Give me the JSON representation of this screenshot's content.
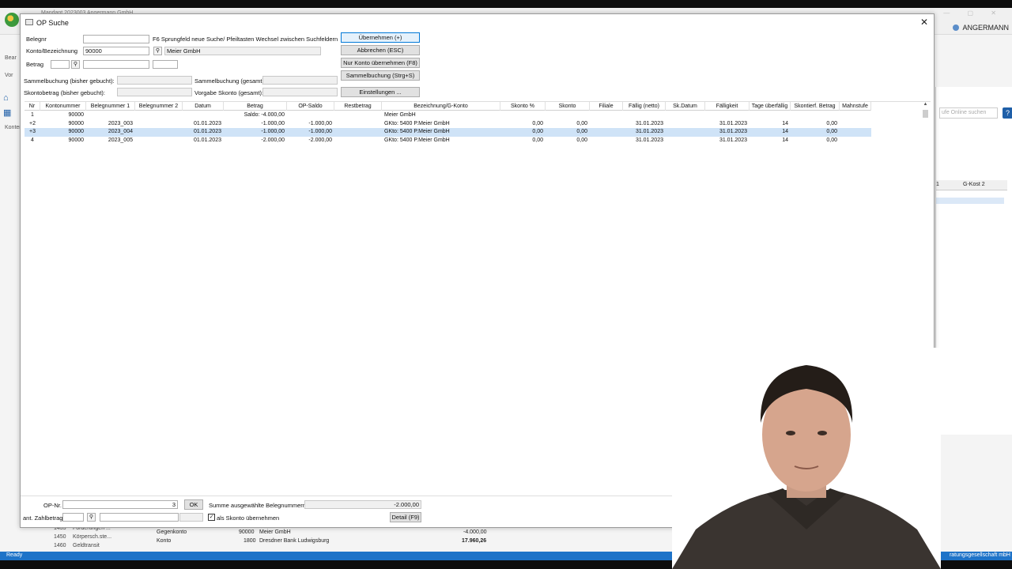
{
  "background_app": {
    "doc_title": "Mandant 2023003 Angermann GmbH",
    "user_name": "ANGERMANN",
    "left_labels": [
      "Bear",
      "Vor",
      "Konten"
    ],
    "search_placeholder": "ufe Online suchen",
    "gkost_col_prefix": "1",
    "gkost_col": "G-Kost 2",
    "bottom_rows": [
      {
        "label": "Gegenkonto",
        "konto": "90000",
        "name": "Meier GmbH",
        "amount": "-4.000,00"
      },
      {
        "label": "Konto",
        "konto": "1800",
        "name": "Dresdner Bank Ludwigsburg",
        "amount": "17.960,26"
      }
    ],
    "tree_rows": [
      {
        "num": "1435",
        "name": "Forderungen ..."
      },
      {
        "num": "1450",
        "name": "Körpersch.ste..."
      },
      {
        "num": "1460",
        "name": "Geldtransit"
      }
    ],
    "status_left": "Ready",
    "status_right": "ratungsgesellschaft mbH"
  },
  "dialog": {
    "title": "OP Suche",
    "close_symbol": "✕",
    "belegnr_label": "Belegnr",
    "belegnr_value": "",
    "hint_text": "F6 Sprungfeld neue Suche/ Pfeiltasten Wechsel zwischen Suchfeldern",
    "konto_label": "Konto/Bezeichnung",
    "konto_value": "90000",
    "konto_name": "Meier GmbH",
    "betrag_label": "Betrag",
    "sammel_bisher_label": "Sammelbuchung (bisher gebucht):",
    "sammel_gesamt_label": "Sammelbuchung (gesamt):",
    "skonto_bisher_label": "Skontobetrag (bisher gebucht):",
    "vorgabe_skonto_label": "Vorgabe Skonto (gesamt):",
    "buttons": {
      "uebernehmen": "Übernehmen (+)",
      "abbrechen": "Abbrechen (ESC)",
      "nur_konto": "Nur Konto übernehmen (F8)",
      "sammelbuchung": "Sammelbuchung (Strg+S)",
      "einstellungen": "Einstellungen ..."
    }
  },
  "table": {
    "headers": [
      "Nr",
      "Kontonummer",
      "Belegnummer 1",
      "Belegnummer 2",
      "Datum",
      "Betrag",
      "OP-Saldo",
      "Restbetrag",
      "Bezeichnung/G-Konto",
      "Skonto %",
      "Skonto",
      "Filiale",
      "Fällig (netto)",
      "Sk.Datum",
      "Fälligkeit",
      "Tage überfällig",
      "Skontierf. Betrag",
      "Mahnstufe"
    ],
    "rows": [
      {
        "nr": "1",
        "konto": "90000",
        "beleg1": "",
        "beleg2": "",
        "datum": "",
        "betrag": "Saldo: -4.000,00",
        "opsaldo": "",
        "rest": "",
        "bez": "Meier GmbH",
        "skp": "",
        "sk": "",
        "fil": "",
        "faellig": "",
        "skdat": "",
        "faelligkeit": "",
        "tage": "",
        "skbetrag": "",
        "mahn": ""
      },
      {
        "nr": "+2",
        "konto": "90000",
        "beleg1": "2023_003",
        "beleg2": "",
        "datum": "01.01.2023",
        "betrag": "-1.000,00",
        "opsaldo": "-1.000,00",
        "rest": "",
        "bez": "GKto: 5400 P.Meier GmbH",
        "skp": "0,00",
        "sk": "0,00",
        "fil": "",
        "faellig": "31.01.2023",
        "skdat": "",
        "faelligkeit": "31.01.2023",
        "tage": "14",
        "skbetrag": "0,00",
        "mahn": ""
      },
      {
        "nr": "+3",
        "konto": "90000",
        "beleg1": "2023_004",
        "beleg2": "",
        "datum": "01.01.2023",
        "betrag": "-1.000,00",
        "opsaldo": "-1.000,00",
        "rest": "",
        "bez": "GKto: 5400 P.Meier GmbH",
        "skp": "0,00",
        "sk": "0,00",
        "fil": "",
        "faellig": "31.01.2023",
        "skdat": "",
        "faelligkeit": "31.01.2023",
        "tage": "14",
        "skbetrag": "0,00",
        "mahn": ""
      },
      {
        "nr": "4",
        "konto": "90000",
        "beleg1": "2023_005",
        "beleg2": "",
        "datum": "01.01.2023",
        "betrag": "-2.000,00",
        "opsaldo": "-2.000,00",
        "rest": "",
        "bez": "GKto: 5400 P.Meier GmbH",
        "skp": "0,00",
        "sk": "0,00",
        "fil": "",
        "faellig": "31.01.2023",
        "skdat": "",
        "faelligkeit": "31.01.2023",
        "tage": "14",
        "skbetrag": "0,00",
        "mahn": ""
      }
    ]
  },
  "footer": {
    "opnr_label": "OP-Nr.",
    "opnr_value": "3",
    "ok_label": "OK",
    "summe_label": "Summe ausgewählte Belegnummern:",
    "summe_value": "-2.000,00",
    "zahlbetrag_label": "ant. Zahlbetrag",
    "skonto_check_label": "als Skonto übernehmen",
    "skonto_checked_symbol": "✓",
    "detail_label": "Detail (F9)"
  },
  "colors": {
    "status_bar": "#1e73c8",
    "selection": "#cfe3f7",
    "default_button_border": "#0078d7"
  }
}
